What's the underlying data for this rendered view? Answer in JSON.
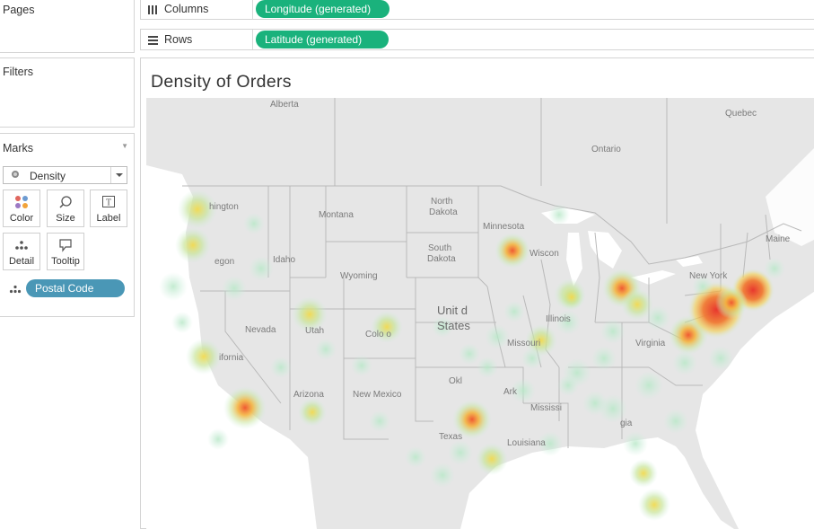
{
  "left_panel": {
    "pages_title": "Pages",
    "filters_title": "Filters",
    "marks_title": "Marks",
    "mark_type": "Density",
    "mark_buttons": [
      {
        "label": "Color",
        "icon": "color-dots-icon"
      },
      {
        "label": "Size",
        "icon": "size-magnifier-icon"
      },
      {
        "label": "Label",
        "icon": "label-t-icon"
      },
      {
        "label": "Detail",
        "icon": "detail-dots-icon"
      },
      {
        "label": "Tooltip",
        "icon": "tooltip-bubble-icon"
      }
    ],
    "detail_field": "Postal Code"
  },
  "shelves": {
    "columns_label": "Columns",
    "columns_pill": "Longitude (generated)",
    "rows_label": "Rows",
    "rows_pill": "Latitude (generated)"
  },
  "viz": {
    "title": "Density of Orders",
    "map_labels": {
      "alberta": "Alberta",
      "quebec": "Quebec",
      "ontario": "Ontario",
      "washington": "hington",
      "oregon": "egon",
      "idaho": "Idaho",
      "montana": "Montana",
      "wyoming": "Wyoming",
      "north_dakota_1": "North",
      "north_dakota_2": "Dakota",
      "south_dakota_1": "South",
      "south_dakota_2": "Dakota",
      "minnesota": "Minnesota",
      "wisconsin": "Wiscon",
      "maine": "Maine",
      "new_york": "New York",
      "nevada": "Nevada",
      "utah": "Utah",
      "colorado": "Colo   o",
      "california": "ifornia",
      "united_1": "Unit d",
      "united_2": "States",
      "illinois": "Illinois",
      "missouri": "Missouri",
      "virginia": "Virginia",
      "arizona": "Arizona",
      "new_mexico": "New Mexico",
      "oklahoma": "Okl",
      "arkansas": "Ark",
      "mississippi": "Mississi",
      "texas": "Texas",
      "louisiana": "Louisiana",
      "georgia": "gia"
    }
  },
  "colors": {
    "pill_green": "#1ab27c",
    "pill_blue": "#4a97b6",
    "land": "#e6e6e6",
    "water": "#ffffff",
    "border": "#b9b9b9"
  }
}
